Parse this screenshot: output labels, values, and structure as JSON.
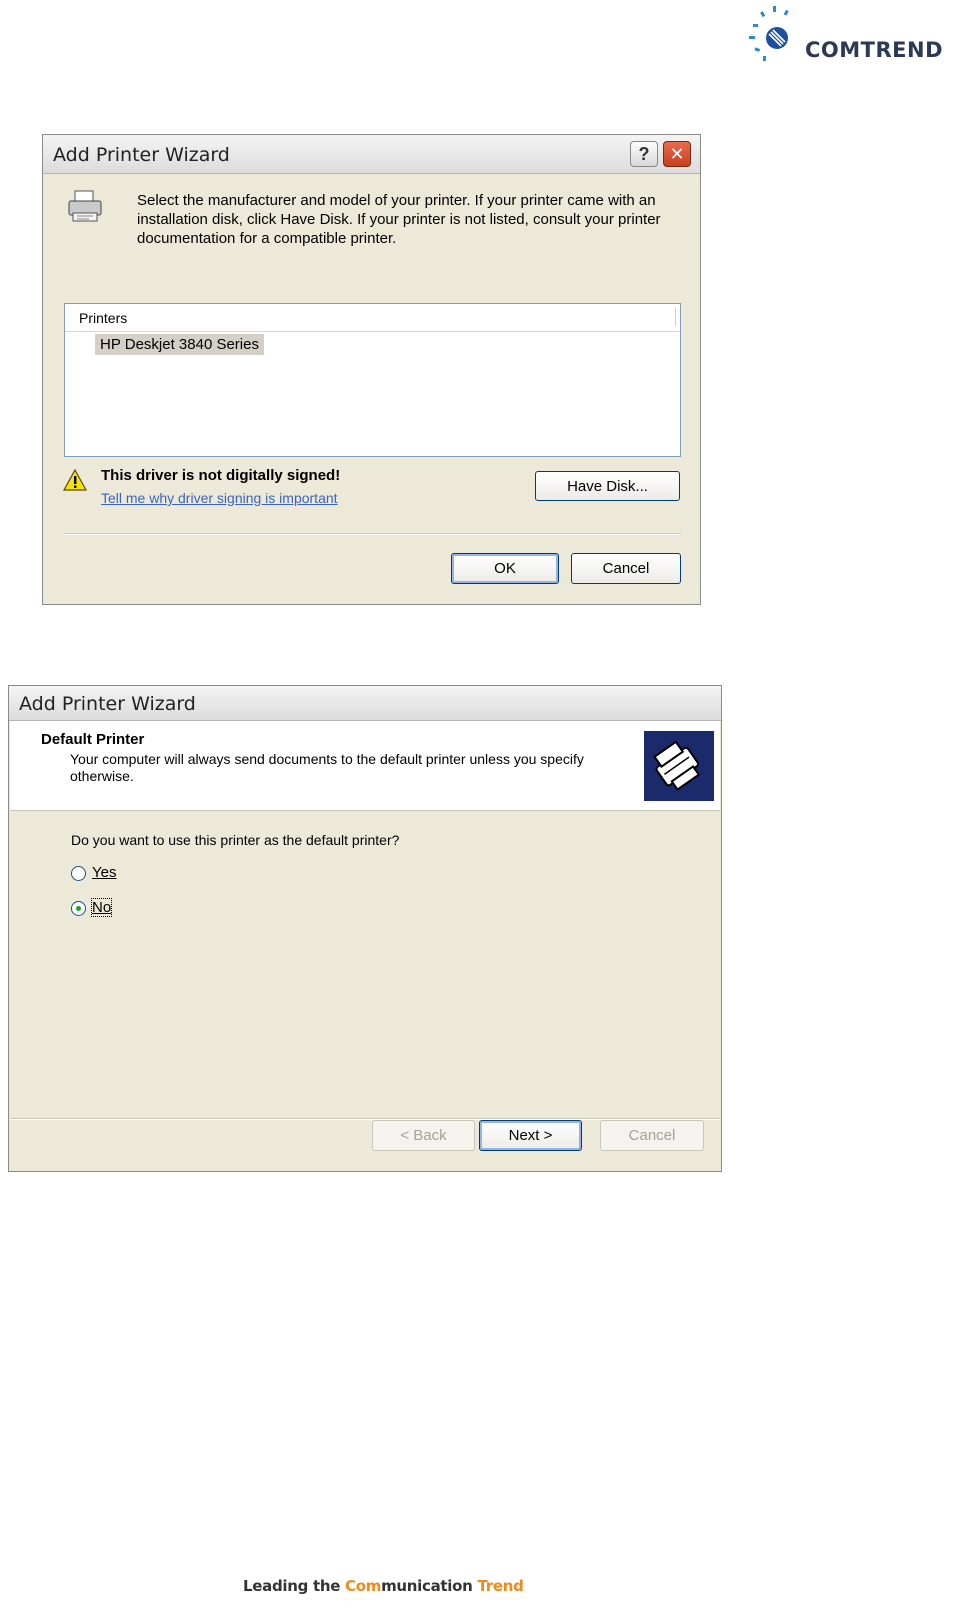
{
  "logo": {
    "text": "COMTREND"
  },
  "wizard1": {
    "title": "Add Printer Wizard",
    "description": "Select the manufacturer and model of your printer. If your printer came with an installation disk, click Have Disk. If your printer is not listed, consult your printer documentation for a compatible printer.",
    "list_header": "Printers",
    "printers": [
      "HP Deskjet 3840 Series"
    ],
    "warning": "This driver is not digitally signed!",
    "warning_link": "Tell me why driver signing is important",
    "have_disk_label": "Have Disk...",
    "ok_label": "OK",
    "cancel_label": "Cancel",
    "help_glyph": "?",
    "close_glyph": "✕",
    "icons": [
      "printer-icon",
      "warning-icon",
      "help-icon",
      "close-icon"
    ]
  },
  "wizard2": {
    "title": "Add Printer Wizard",
    "header_title": "Default Printer",
    "header_desc": "Your computer will always send documents to the default printer unless you specify otherwise.",
    "question": "Do you want to use this printer as the default printer?",
    "options": [
      {
        "label": "Yes",
        "selected": false
      },
      {
        "label": "No",
        "selected": true
      }
    ],
    "back_label": "< Back",
    "next_label": "Next >",
    "cancel_label": "Cancel",
    "icons": [
      "printer-wizard-icon"
    ]
  },
  "footer": {
    "part1": "Leading the ",
    "part2": "Com",
    "part3": "munication ",
    "part4": "Trend"
  },
  "colors": {
    "window_bg": "#ece9d8",
    "accent_orange": "#f08a1d",
    "link_blue": "#3a64c4"
  }
}
